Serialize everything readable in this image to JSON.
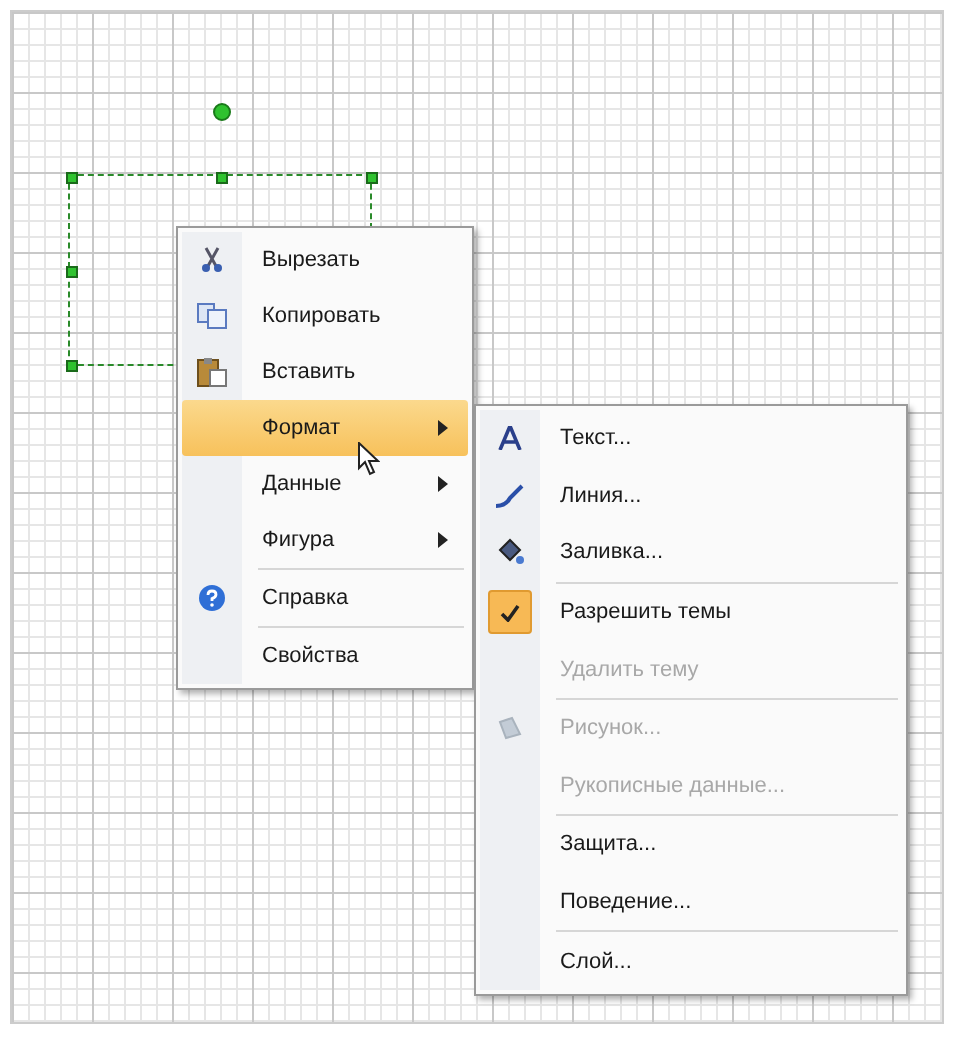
{
  "shape": {
    "selected": true
  },
  "context_menu": {
    "items": [
      {
        "kind": "item",
        "label": "Вырезать",
        "selected": false,
        "submenu": false
      },
      {
        "kind": "item",
        "label": "Копировать",
        "selected": false,
        "submenu": false
      },
      {
        "kind": "item",
        "label": "Вставить",
        "selected": false,
        "submenu": false
      },
      {
        "kind": "item",
        "label": "Формат",
        "selected": true,
        "submenu": true
      },
      {
        "kind": "item",
        "label": "Данные",
        "selected": false,
        "submenu": true
      },
      {
        "kind": "item",
        "label": "Фигура",
        "selected": false,
        "submenu": true
      },
      {
        "kind": "separator"
      },
      {
        "kind": "item",
        "label": "Справка",
        "selected": false,
        "submenu": false
      },
      {
        "kind": "separator"
      },
      {
        "kind": "item",
        "label": "Свойства",
        "selected": false,
        "submenu": false
      }
    ]
  },
  "submenu": {
    "items": [
      {
        "kind": "item",
        "label": "Текст...",
        "disabled": false,
        "checked": false
      },
      {
        "kind": "item",
        "label": "Линия...",
        "disabled": false,
        "checked": false
      },
      {
        "kind": "item",
        "label": "Заливка...",
        "disabled": false,
        "checked": false
      },
      {
        "kind": "separator"
      },
      {
        "kind": "item",
        "label": "Разрешить темы",
        "disabled": false,
        "checked": true
      },
      {
        "kind": "item",
        "label": "Удалить тему",
        "disabled": true,
        "checked": false
      },
      {
        "kind": "separator"
      },
      {
        "kind": "item",
        "label": "Рисунок...",
        "disabled": true,
        "checked": false
      },
      {
        "kind": "item",
        "label": "Рукописные данные...",
        "disabled": true,
        "checked": false
      },
      {
        "kind": "separator"
      },
      {
        "kind": "item",
        "label": "Защита...",
        "disabled": false,
        "checked": false
      },
      {
        "kind": "item",
        "label": "Поведение...",
        "disabled": false,
        "checked": false
      },
      {
        "kind": "separator"
      },
      {
        "kind": "item",
        "label": "Слой...",
        "disabled": false,
        "checked": false
      }
    ]
  }
}
